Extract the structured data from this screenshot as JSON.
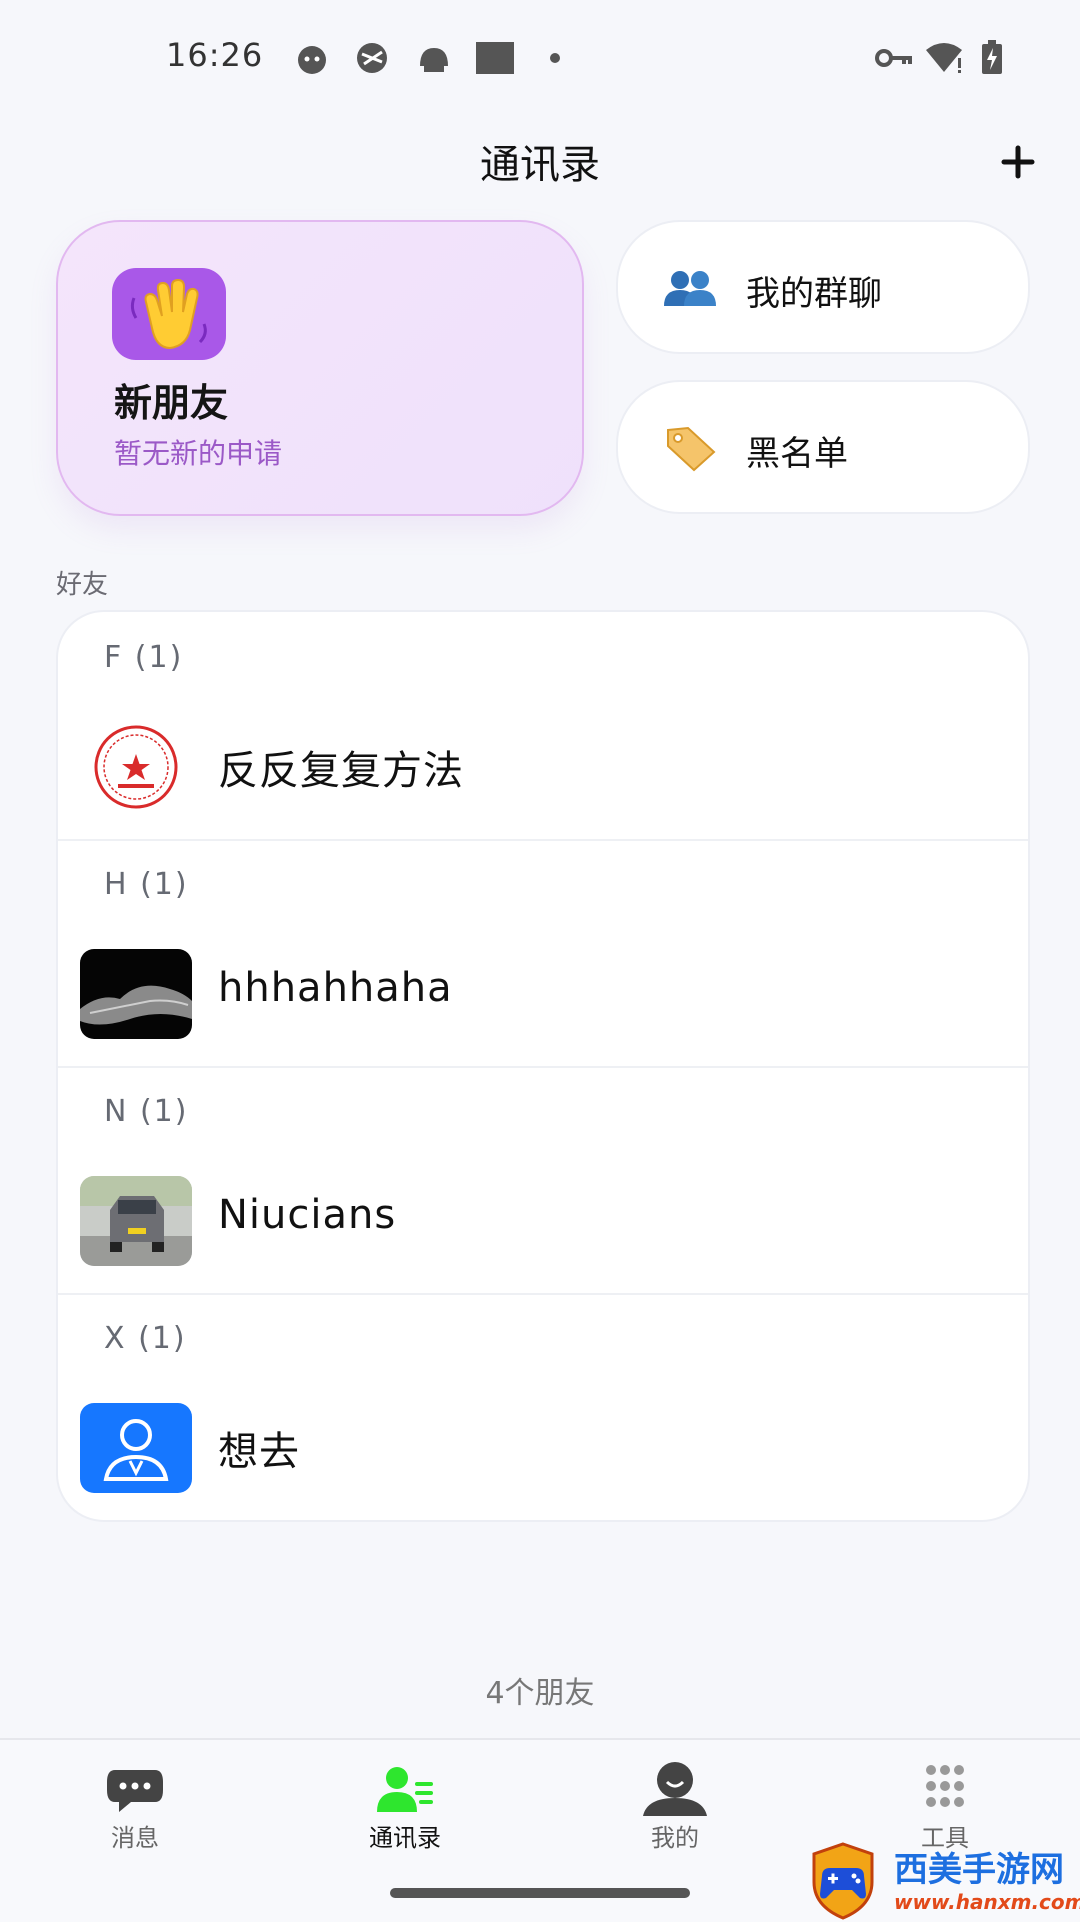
{
  "status_bar": {
    "time": "16:26"
  },
  "header": {
    "title": "通讯录"
  },
  "cards": {
    "new_friends": {
      "title": "新朋友",
      "subtitle": "暂无新的申请"
    },
    "groups": {
      "label": "我的群聊"
    },
    "blacklist": {
      "label": "黑名单"
    }
  },
  "section_label": "好友",
  "friends": [
    {
      "header": "F (1)",
      "name": "反反复复方法"
    },
    {
      "header": "H (1)",
      "name": "hhhahhaha"
    },
    {
      "header": "N (1)",
      "name": "Niucians"
    },
    {
      "header": "X (1)",
      "name": "想去"
    }
  ],
  "friend_count": "4个朋友",
  "nav": [
    {
      "label": "消息",
      "icon": "chat-bubble-icon"
    },
    {
      "label": "通讯录",
      "icon": "contacts-icon",
      "active": true
    },
    {
      "label": "我的",
      "icon": "profile-icon"
    },
    {
      "label": "工具",
      "icon": "grid-icon"
    }
  ],
  "watermark": {
    "text": "西美手游网",
    "url": "www.hanxm.com"
  },
  "colors": {
    "accent_green": "#2ee62e",
    "purple_badge": "#a958e8",
    "avatar_blue": "#1677ff"
  }
}
